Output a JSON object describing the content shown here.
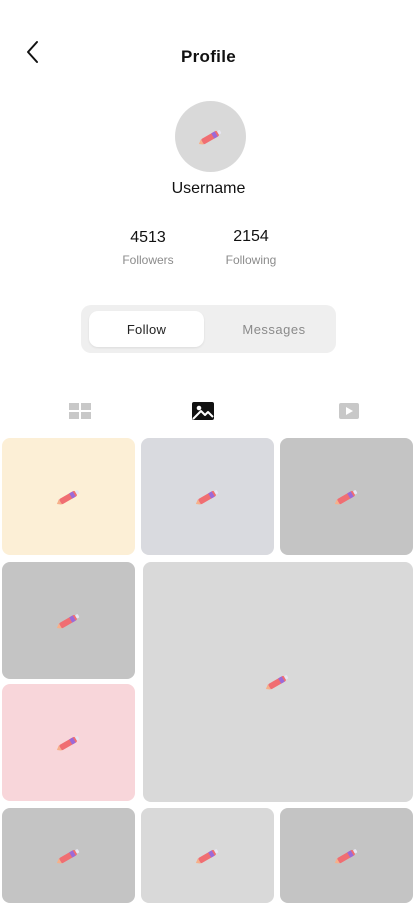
{
  "header": {
    "title": "Profile",
    "back_icon": "chevron-left-icon"
  },
  "profile": {
    "username": "Username",
    "avatar_icon": "pencil-edit-icon"
  },
  "stats": {
    "followers_count": "4513",
    "followers_label": "Followers",
    "following_count": "2154",
    "following_label": "Following"
  },
  "actions": {
    "follow_label": "Follow",
    "messages_label": "Messages",
    "selected": "Follow"
  },
  "tabs": [
    {
      "icon": "grid-icon",
      "selected": false
    },
    {
      "icon": "photo-icon",
      "selected": true
    },
    {
      "icon": "video-play-icon",
      "selected": false
    }
  ],
  "gallery": {
    "tile_icon": "pencil-edit-icon",
    "tile_colors": [
      "#fcefd6",
      "#d9dadf",
      "#c4c4c4",
      "#c4c4c4",
      "#d9d9d9",
      "#f8d6da",
      "#c4c4c4",
      "#d9d9d9",
      "#c4c4c4"
    ]
  }
}
